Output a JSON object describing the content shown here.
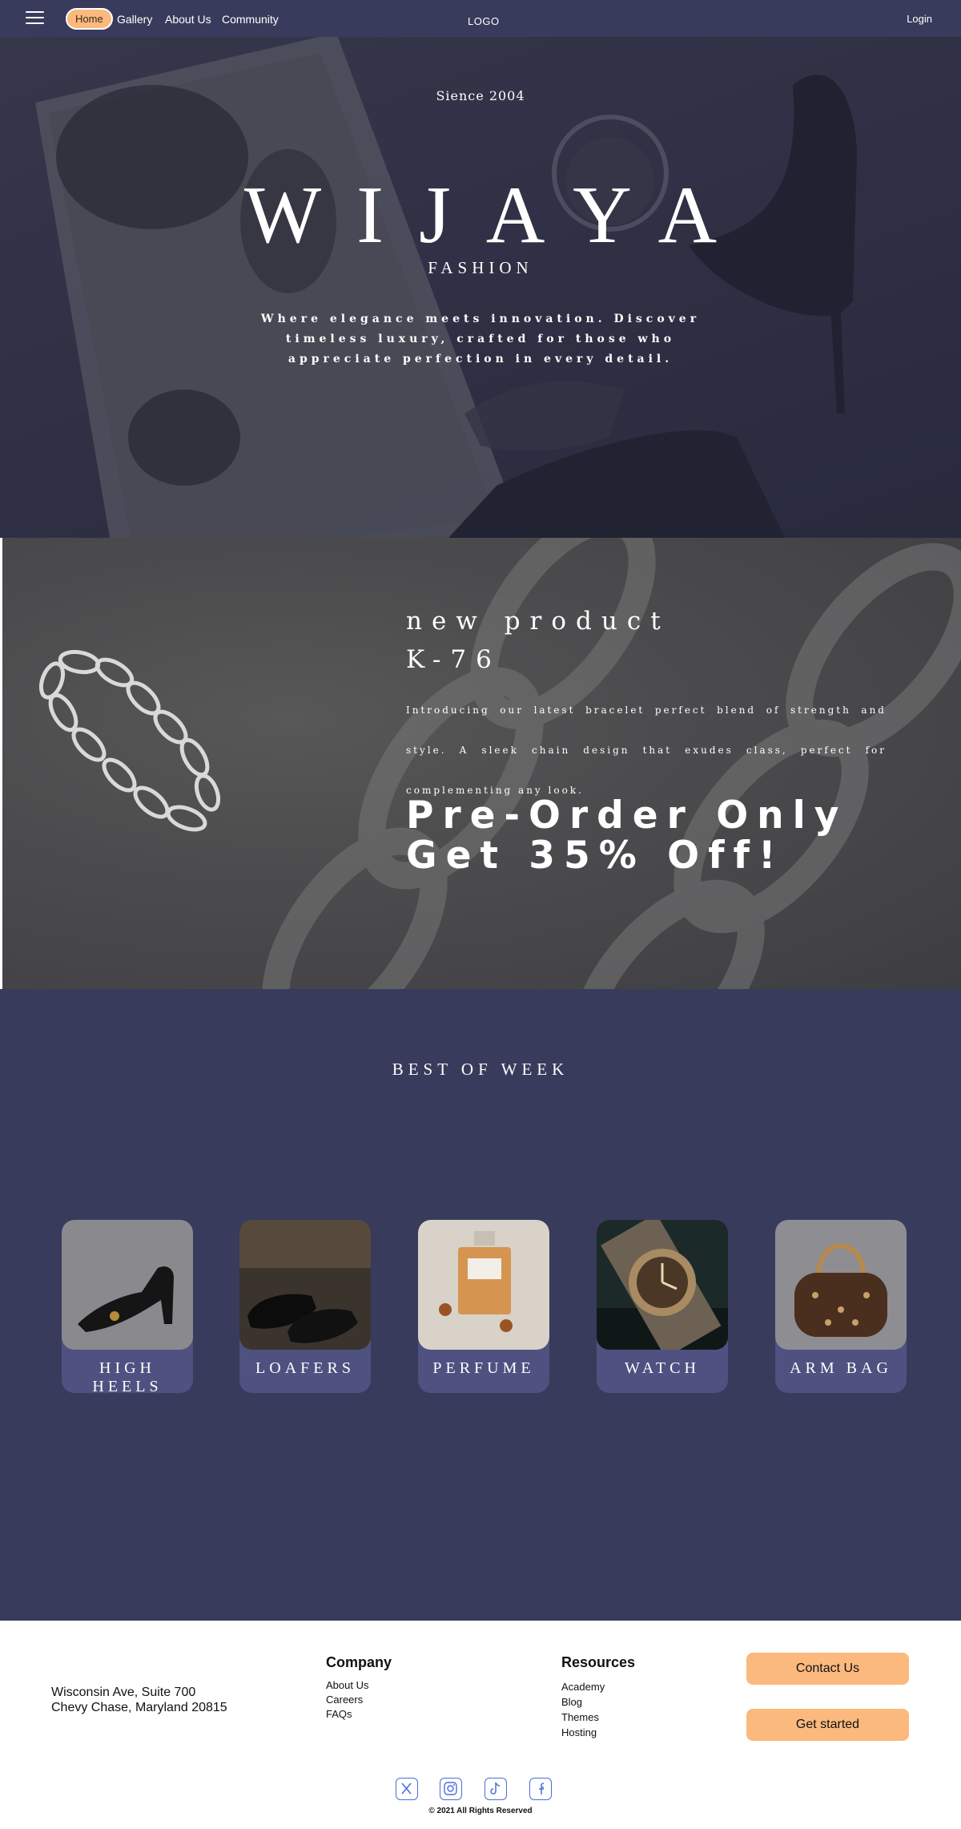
{
  "nav": {
    "links": [
      "Home",
      "Gallery",
      "About Us",
      "Community"
    ],
    "logo": "LOGO",
    "login": "Login",
    "accent": "#fbb97e",
    "background": "#393b5c"
  },
  "hero": {
    "since": "Sience  2004",
    "title": "WIJAYA",
    "subtitle": "FASHION",
    "tagline": "Where elegance meets innovation. Discover timeless luxury, crafted for those who appreciate perfection in every detail."
  },
  "product": {
    "heading_line1": "new product",
    "heading_line2": "K-76",
    "description": "Introducing our latest bracelet perfect blend of strength and style. A sleek chain design that exudes class, perfect for complementing any look.",
    "promo_line1": "Pre-Order Only",
    "promo_line2": "Get 35% Off!"
  },
  "best": {
    "title": "BEST OF WEEK",
    "items": [
      {
        "label": "HIGH HEELS",
        "icon": "high-heel-shoe-image"
      },
      {
        "label": "LOAFERS",
        "icon": "loafers-image"
      },
      {
        "label": "PERFUME",
        "icon": "perfume-bottle-image"
      },
      {
        "label": "WATCH",
        "icon": "wrist-watch-image"
      },
      {
        "label": "ARM BAG",
        "icon": "handbag-image"
      }
    ]
  },
  "footer": {
    "address_line1": "Wisconsin Ave, Suite 700",
    "address_line2": "Chevy Chase, Maryland 20815",
    "company": {
      "heading": "Company",
      "links": [
        "About Us",
        "Careers",
        "FAQs"
      ]
    },
    "resources": {
      "heading": "Resources",
      "links": [
        "Academy",
        "Blog",
        "Themes",
        "Hosting"
      ]
    },
    "contact_button": "Contact Us",
    "start_button": "Get started",
    "socials": [
      "x-icon",
      "instagram-icon",
      "tiktok-icon",
      "facebook-icon"
    ],
    "copyright": "© 2021 All Rights Reserved"
  }
}
